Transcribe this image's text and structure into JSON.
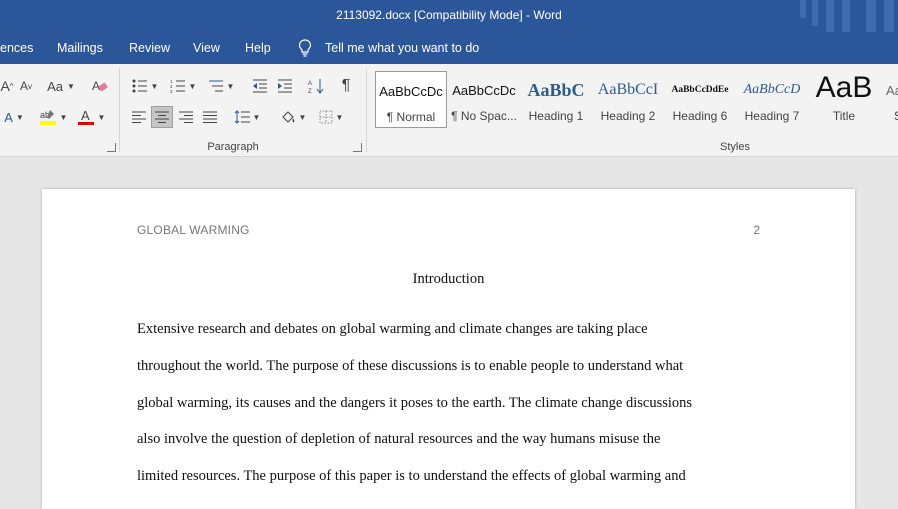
{
  "window": {
    "title": "2113092.docx [Compatibility Mode]  -  Word"
  },
  "menu": {
    "items": [
      "ences",
      "Mailings",
      "Review",
      "View",
      "Help"
    ],
    "tell_me": "Tell me what you want to do"
  },
  "ribbon": {
    "paragraph_label": "Paragraph",
    "styles_label": "Styles",
    "font_buttons": {
      "grow": "A",
      "shrink": "A",
      "change_case": "Aa",
      "text_effects": "A",
      "font_color": "A"
    },
    "styles": [
      {
        "preview": "AaBbCcDc",
        "name": "¶ Normal",
        "selected": true
      },
      {
        "preview": "AaBbCcDc",
        "name": "¶ No Spac..."
      },
      {
        "preview": "AaBbC",
        "name": "Heading 1"
      },
      {
        "preview": "AaBbCcI",
        "name": "Heading 2"
      },
      {
        "preview": "AaBbCcDdEe",
        "name": "Heading 6"
      },
      {
        "preview": "AaBbCcD",
        "name": "Heading 7"
      },
      {
        "preview": "AaB",
        "name": "Title"
      },
      {
        "preview": "Aa",
        "name": "S"
      }
    ],
    "colors": {
      "highlight": "#ffff00",
      "font_color": "#e00000"
    }
  },
  "document": {
    "running_head": "GLOBAL WARMING",
    "page_number": "2",
    "heading": "Introduction",
    "lines": [
      "Extensive research and debates on global warming and climate changes are taking place",
      "throughout the world.  The purpose of these discussions is to enable people to understand what",
      "global warming, its causes and the dangers it poses to the earth. The climate change discussions",
      "also involve the question of depletion of natural resources and the way humans misuse the",
      "limited resources. The purpose of this paper is to understand the effects of global warming and"
    ]
  }
}
